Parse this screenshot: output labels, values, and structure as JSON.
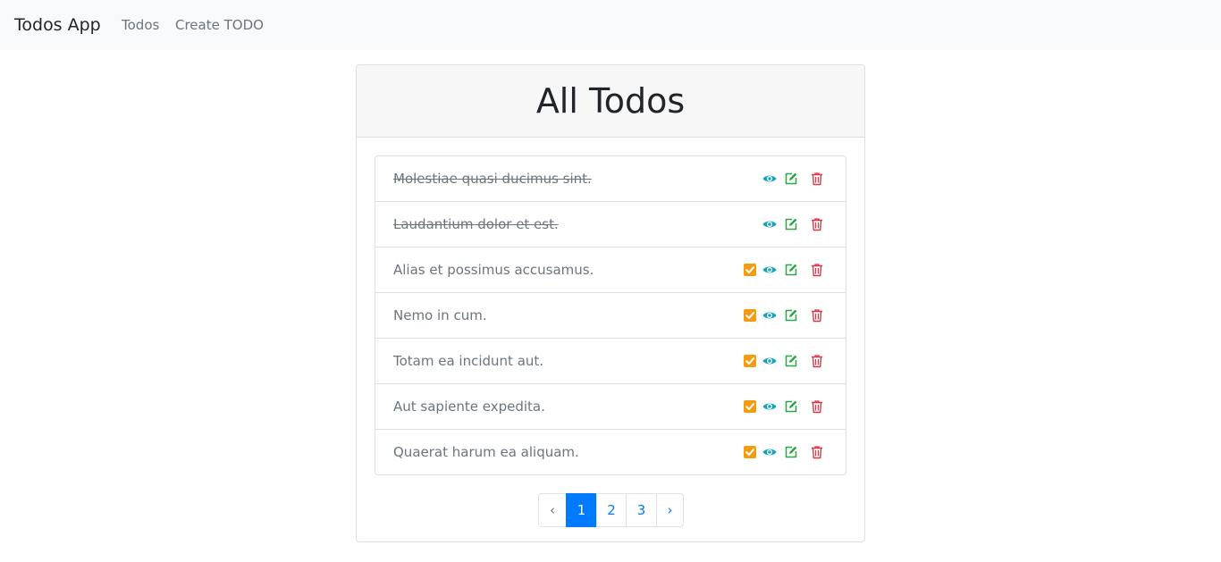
{
  "navbar": {
    "brand": "Todos App",
    "links": [
      "Todos",
      "Create TODO"
    ]
  },
  "card": {
    "title": "All Todos"
  },
  "todos": [
    {
      "text": "Molestiae quasi ducimus sint.",
      "completed": true
    },
    {
      "text": "Laudantium dolor et est.",
      "completed": true
    },
    {
      "text": "Alias et possimus accusamus.",
      "completed": false
    },
    {
      "text": "Nemo in cum.",
      "completed": false
    },
    {
      "text": "Totam ea incidunt aut.",
      "completed": false
    },
    {
      "text": "Aut sapiente expedita.",
      "completed": false
    },
    {
      "text": "Quaerat harum ea aliquam.",
      "completed": false
    }
  ],
  "icons": {
    "complete": "check-square-icon",
    "view": "eye-icon",
    "edit": "edit-icon",
    "delete": "trash-icon"
  },
  "colors": {
    "check": "#f39c12",
    "view": "#17a2b8",
    "edit": "#28a745",
    "delete": "#dc3545",
    "active_page": "#007bff"
  },
  "pagination": {
    "prev": "‹",
    "pages": [
      "1",
      "2",
      "3"
    ],
    "next": "›",
    "current": "1"
  }
}
